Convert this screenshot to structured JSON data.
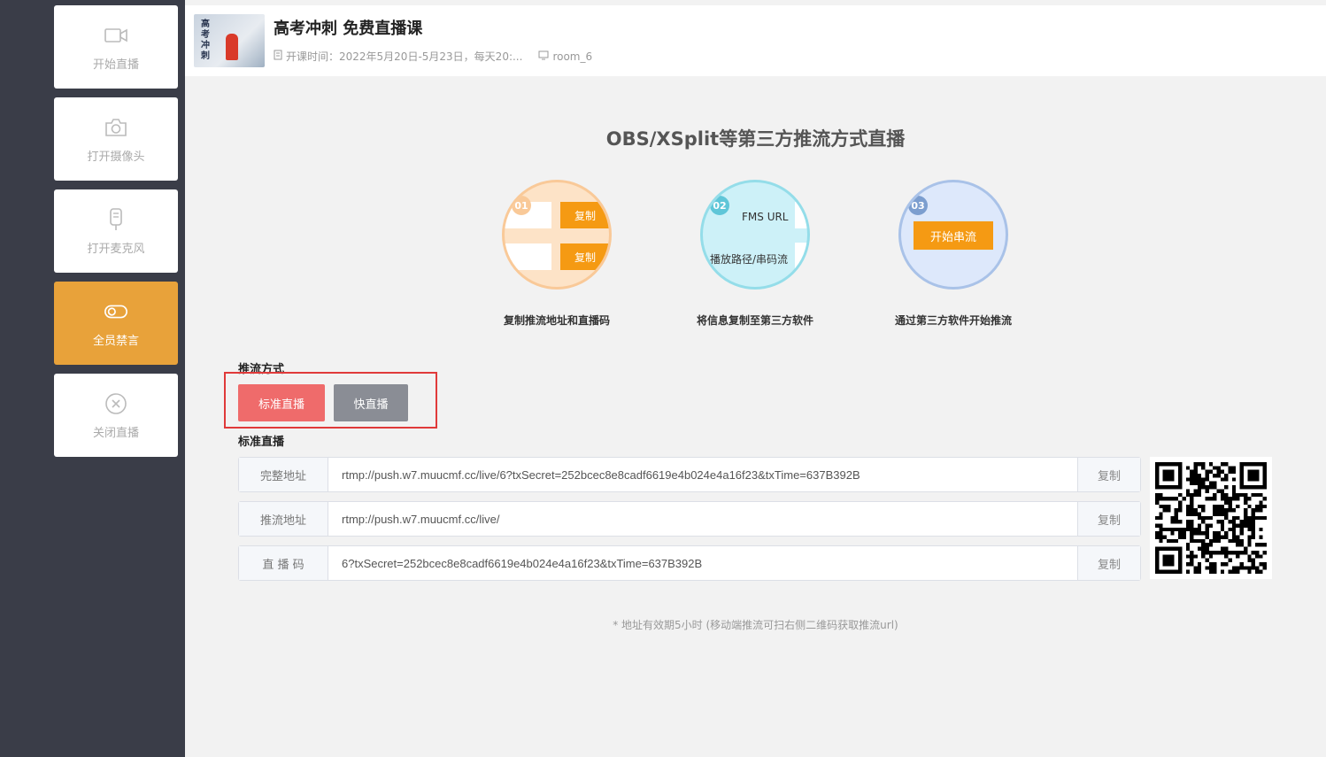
{
  "sidebar": {
    "items": [
      {
        "label": "开始直播",
        "icon": "video-camera-icon"
      },
      {
        "label": "打开摄像头",
        "icon": "camera-icon"
      },
      {
        "label": "打开麦克风",
        "icon": "microphone-icon"
      },
      {
        "label": "全员禁言",
        "icon": "toggle-icon",
        "active": true
      },
      {
        "label": "关闭直播",
        "icon": "close-circle-icon"
      }
    ]
  },
  "course": {
    "cover_text": "高考冲刺",
    "title": "高考冲刺 免费直播课",
    "time_label": "开课时间：2022年5月20日-5月23日，每天20:...",
    "room": "room_6"
  },
  "heading": "OBS/XSplit等第三方推流方式直播",
  "steps": [
    {
      "num": "01",
      "caption": "复制推流地址和直播码",
      "copy1": "复制",
      "copy2": "复制"
    },
    {
      "num": "02",
      "caption": "将信息复制至第三方软件",
      "line1": "FMS URL",
      "line2": "播放路径/串码流"
    },
    {
      "num": "03",
      "caption": "通过第三方软件开始推流",
      "button": "开始串流"
    }
  ],
  "method": {
    "label": "推流方式",
    "standard": "标准直播",
    "fast": "快直播"
  },
  "standard_section": {
    "label": "标准直播",
    "rows": [
      {
        "label": "完整地址",
        "value": "rtmp://push.w7.muucmf.cc/live/6?txSecret=252bcec8e8cadf6619e4b024e4a16f23&txTime=637B392B",
        "copy": "复制"
      },
      {
        "label": "推流地址",
        "value": "rtmp://push.w7.muucmf.cc/live/",
        "copy": "复制"
      },
      {
        "label": "直 播 码",
        "value": "6?txSecret=252bcec8e8cadf6619e4b024e4a16f23&txTime=637B392B",
        "copy": "复制"
      }
    ]
  },
  "note": "* 地址有效期5小时 (移动端推流可扫右侧二维码获取推流url)",
  "colors": {
    "sidebar_bg": "#3a3d48",
    "active_item": "#e8a23a",
    "accent_orange": "#f59a13",
    "standard_btn": "#ef6b6b",
    "fast_btn": "#8a8d95",
    "highlight_border": "#e03a3a"
  }
}
